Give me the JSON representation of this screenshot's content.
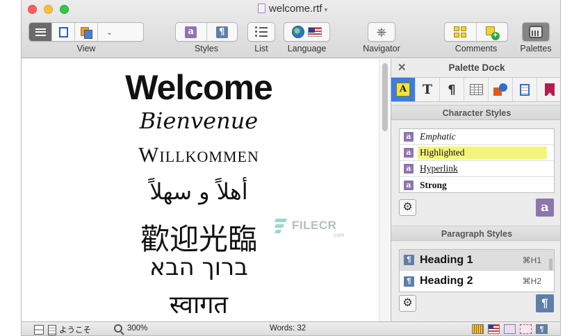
{
  "window": {
    "title": "welcome.rtf"
  },
  "toolbar": {
    "view_label": "View",
    "styles_label": "Styles",
    "list_label": "List",
    "language_label": "Language",
    "navigator_label": "Navigator",
    "comments_label": "Comments",
    "palettes_label": "Palettes"
  },
  "document": {
    "lines": [
      "Welcome",
      "Bienvenue",
      "Willkommen",
      "أهلاً و سهلاً",
      "歡迎光臨",
      "ברוך הבא",
      "स्वागत"
    ]
  },
  "watermark": {
    "text": "FILECR",
    "sub": ".com"
  },
  "dock": {
    "title": "Palette Dock",
    "close_glyph": "✕",
    "character_styles_header": "Character Styles",
    "character_styles": [
      {
        "name": "Emphatic"
      },
      {
        "name": "Highlighted"
      },
      {
        "name": "Hyperlink"
      },
      {
        "name": "Strong"
      }
    ],
    "paragraph_styles_header": "Paragraph Styles",
    "paragraph_styles": [
      {
        "name": "Heading 1",
        "shortcut": "⌘H1",
        "selected": true
      },
      {
        "name": "Heading 2",
        "shortcut": "⌘H2",
        "selected": false
      }
    ],
    "tab_icons": [
      "character-style-icon",
      "text-icon",
      "paragraph-icon",
      "table-icon",
      "shapes-icon",
      "box-icon",
      "bookmark-icon"
    ]
  },
  "status": {
    "page_text": "ようこそ",
    "zoom": "300%",
    "words": "Words: 32"
  },
  "colors": {
    "style_accent": "#8d76b0",
    "paragraph_accent": "#5f7ea8",
    "highlight": "#f3f57a",
    "link": "#1c2fd8",
    "active_tab": "#3b7de0"
  }
}
